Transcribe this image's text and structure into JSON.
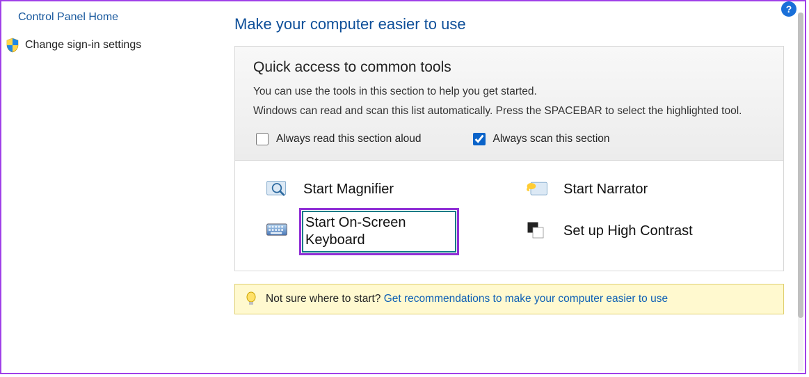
{
  "sidebar": {
    "home_link": "Control Panel Home",
    "signin_link": "Change sign-in settings"
  },
  "main": {
    "title": "Make your computer easier to use",
    "quick": {
      "heading": "Quick access to common tools",
      "desc1": "You can use the tools in this section to help you get started.",
      "desc2": "Windows can read and scan this list automatically.  Press the SPACEBAR to select the highlighted tool.",
      "read_aloud_label": "Always read this section aloud",
      "scan_label": "Always scan this section"
    },
    "tools": {
      "magnifier": "Start Magnifier",
      "narrator": "Start Narrator",
      "osk": "Start On-Screen Keyboard",
      "contrast": "Set up High Contrast"
    },
    "hint": {
      "prefix": "Not sure where to start? ",
      "link": "Get recommendations to make your computer easier to use"
    }
  },
  "help_badge": "?"
}
